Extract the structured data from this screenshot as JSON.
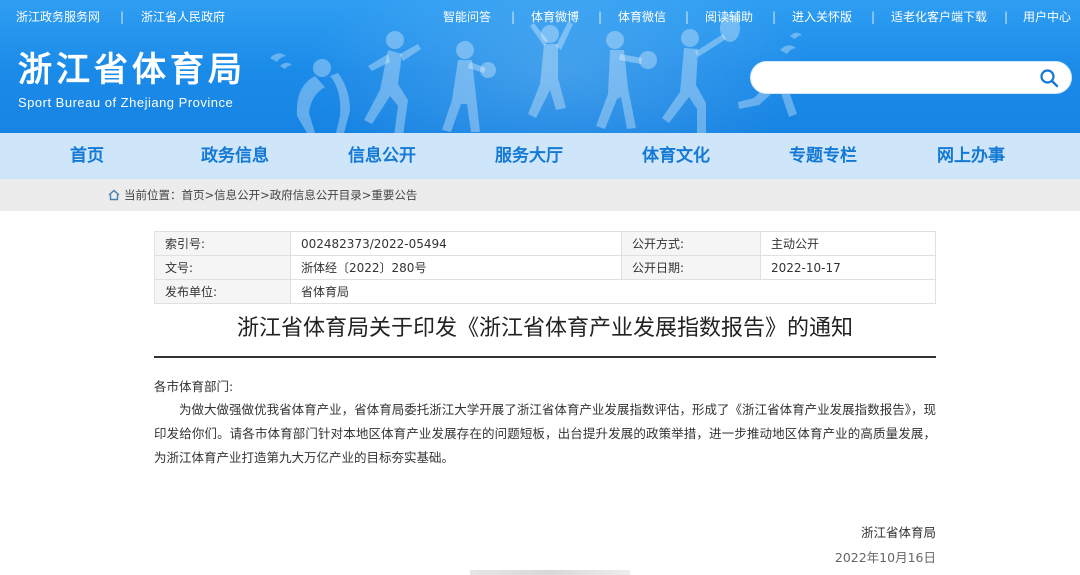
{
  "header": {
    "left_links": [
      "浙江政务服务网",
      "浙江省人民政府"
    ],
    "right_links": [
      "智能问答",
      "体育微博",
      "体育微信",
      "阅读辅助",
      "进入关怀版",
      "适老化客户端下载",
      "用户中心"
    ],
    "separator": "|",
    "site_title": "浙江省体育局",
    "site_subtitle": "Sport Bureau of Zhejiang Province",
    "search": {
      "placeholder": "",
      "value": ""
    }
  },
  "nav": {
    "items": [
      "首页",
      "政务信息",
      "信息公开",
      "服务大厅",
      "体育文化",
      "专题专栏",
      "网上办事"
    ]
  },
  "breadcrumb": {
    "prefix": "当前位置：",
    "items": [
      "首页",
      "信息公开",
      "政府信息公开目录",
      "重要公告"
    ],
    "separator": ">"
  },
  "info_table": {
    "rows": [
      {
        "label1": "索引号:",
        "value1": "002482373/2022-05494",
        "label2": "公开方式:",
        "value2": "主动公开"
      },
      {
        "label1": "文号:",
        "value1": "浙体经〔2022〕280号",
        "label2": "公开日期:",
        "value2": "2022-10-17"
      },
      {
        "label1": "发布单位:",
        "value1": "省体育局",
        "label2": "",
        "value2": ""
      }
    ]
  },
  "article": {
    "title": "浙江省体育局关于印发《浙江省体育产业发展指数报告》的通知",
    "salutation": "各市体育部门:",
    "body": "为做大做强做优我省体育产业，省体育局委托浙江大学开展了浙江省体育产业发展指数评估，形成了《浙江省体育产业发展指数报告》，现印发给你们。请各市体育部门针对本地区体育产业发展存在的问题短板，出台提升发展的政策举措，进一步推动地区体育产业的高质量发展，为浙江体育产业打造第九大万亿产业的目标夯实基础。",
    "signature": "浙江省体育局",
    "date": "2022年10月16日"
  },
  "colors": {
    "banner": "#1a8ae8",
    "nav_bg": "#cfe6fa",
    "nav_text": "#1479d4",
    "crumb_bg": "#ececec"
  }
}
